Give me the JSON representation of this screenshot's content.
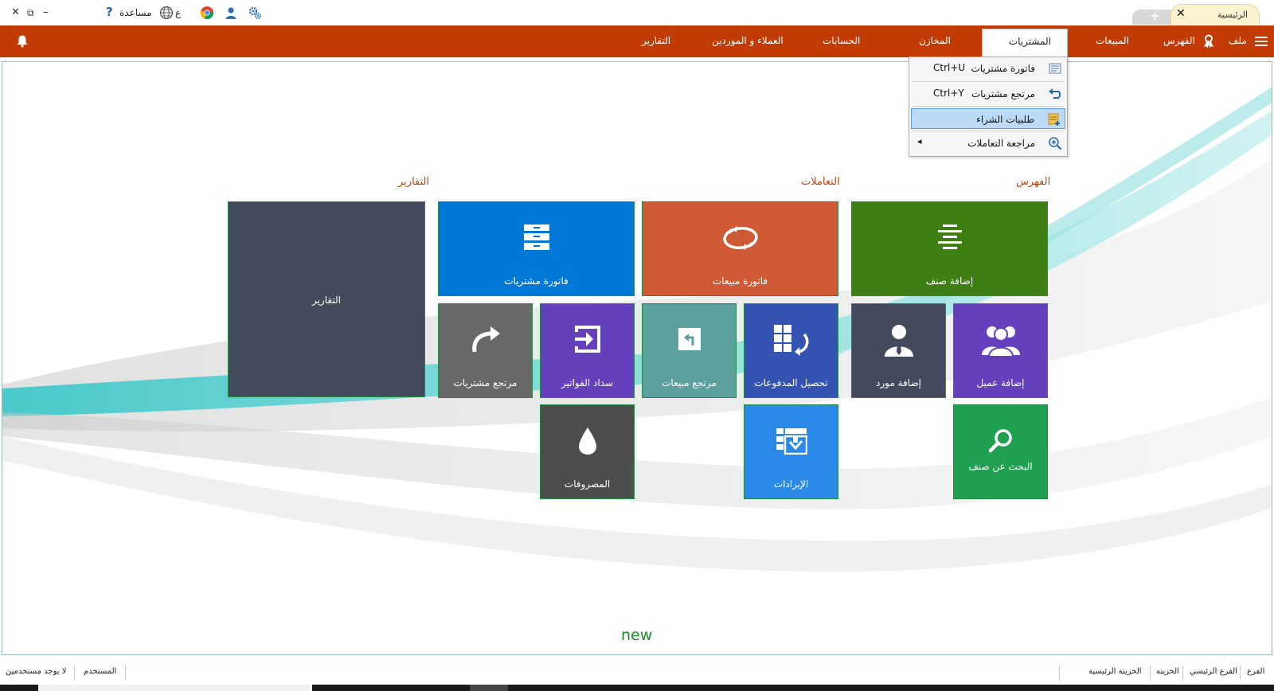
{
  "titlebar": {
    "tab_home_label": "الرئيسية",
    "tab_close": "✕",
    "tab_add": "+",
    "help_label": "مساعدة",
    "help_mark": "?",
    "lang_label": "ع",
    "window_close": "✕",
    "window_restore": "⧉",
    "window_minimize": "–"
  },
  "menubar": {
    "file": "ملف",
    "catalog": "الفهرس",
    "sales": "المبيعات",
    "purchases": "المشتريات",
    "stores": "المخازن",
    "accounts": "الحسابات",
    "customers_suppliers": "العملاء و الموردين",
    "reports": "التقارير"
  },
  "dropdown": {
    "items": [
      {
        "label": "فاتورة مشتريات",
        "shortcut": "Ctrl+U",
        "icon": "invoice-icon"
      },
      {
        "label": "مرتجع مشتريات",
        "shortcut": "Ctrl+Y",
        "icon": "undo-icon"
      },
      {
        "label": "طلبيات الشراء",
        "shortcut": "",
        "icon": "purchase-order-icon"
      },
      {
        "label": "مراجعة التعاملات",
        "shortcut": "",
        "icon": "zoom-in-icon",
        "submenu_arrow": "◂"
      }
    ],
    "selected_index": 2
  },
  "sections": {
    "catalog": "الفهرس",
    "transactions": "التعاملات",
    "reports": "التقارير"
  },
  "tiles": {
    "add_item": {
      "label": "إضافة صنف",
      "color": "#3e7f14",
      "icon": "list-lines-icon"
    },
    "sales_invoice": {
      "label": "فاتورة مبيعات",
      "color": "#d15a36",
      "icon": "cycle-icon"
    },
    "purchase_invoice": {
      "label": "فاتورة مشتريات",
      "color": "#0078d7",
      "icon": "cabinet-icon"
    },
    "reports": {
      "label": "التقارير",
      "color": "#434a5b"
    },
    "add_customer": {
      "label": "إضافة عميل",
      "color": "#6540bd",
      "icon": "users-icon"
    },
    "add_supplier": {
      "label": "إضافة مورد",
      "color": "#434a5b",
      "icon": "user-tie-icon"
    },
    "collect_payments": {
      "label": "تحصيل المدفوعات",
      "color": "#3453b3",
      "icon": "grid-return-icon"
    },
    "sales_return": {
      "label": "مرتجع مبيعات",
      "color": "#5da19e",
      "icon": "return-box-icon"
    },
    "pay_bills": {
      "label": "سداد الفواتير",
      "color": "#6540bd",
      "icon": "sign-in-icon"
    },
    "purchase_return": {
      "label": "مرتجع مشتريات",
      "color": "#686868",
      "icon": "redo-icon"
    },
    "search_item": {
      "label": "البحث عن صنف",
      "color": "#20a151",
      "icon": "search-icon"
    },
    "revenues": {
      "label": "الإيرادات",
      "color": "#2b8ae8",
      "icon": "grid-check-icon"
    },
    "expenses": {
      "label": "المصروفات",
      "color": "#4d4d4d",
      "icon": "drop-icon"
    }
  },
  "new_label": "new",
  "statusbar": {
    "branch_label": "الفرع",
    "branch_value": "الفرع الرئيسي",
    "treasury_label": "الخزينه",
    "treasury_value": "الخزينة الرئيسية",
    "user_label": "المستخدم",
    "user_value": "لا يوجد مستخدمين"
  },
  "colors": {
    "menubar": "#c23b04",
    "section_title": "#c94204",
    "tile_border": "#1f8a45",
    "new_label": "#1e8a2a"
  }
}
